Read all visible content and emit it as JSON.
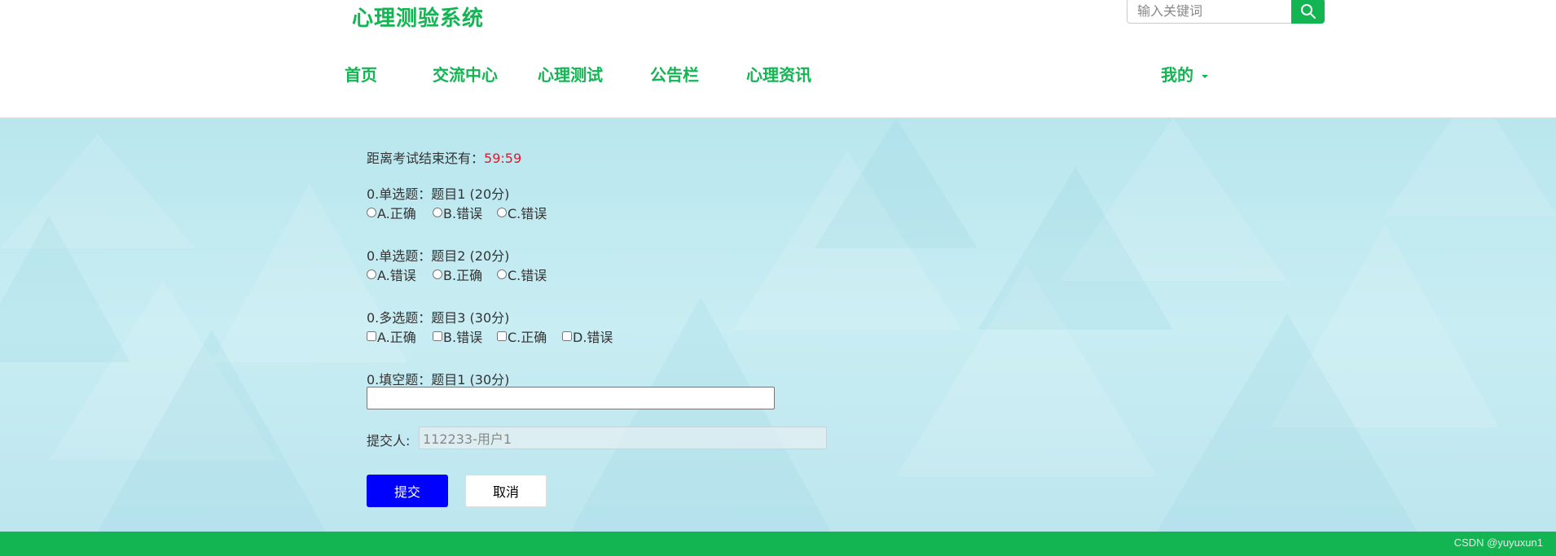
{
  "header": {
    "logo": "心理测验系统",
    "search": {
      "placeholder": "输入关键词",
      "button_icon": "search-icon"
    },
    "nav": [
      {
        "label": "首页"
      },
      {
        "label": "交流中心"
      },
      {
        "label": "心理测试"
      },
      {
        "label": "公告栏"
      },
      {
        "label": "心理资讯"
      }
    ],
    "user_menu": {
      "label": "我的",
      "icon": "caret-down-icon"
    }
  },
  "exam": {
    "timer_label": "距离考试结束还有：",
    "timer_value": "59:59",
    "questions": [
      {
        "title": "0.单选题：题目1 (20分)",
        "type": "radio",
        "options": [
          "A.正确",
          "B.错误",
          "C.错误"
        ]
      },
      {
        "title": "0.单选题：题目2 (20分)",
        "type": "radio",
        "options": [
          "A.错误",
          "B.正确",
          "C.错误"
        ]
      },
      {
        "title": "0.多选题：题目3 (30分)",
        "type": "checkbox",
        "options": [
          "A.正确",
          "B.错误",
          "C.正确",
          "D.错误"
        ]
      },
      {
        "title": "0.填空题：题目1 (30分)",
        "type": "text",
        "value": ""
      }
    ],
    "submitter_label": "提交人:",
    "submitter_value": "112233-用户1",
    "submit_label": "提交",
    "cancel_label": "取消"
  },
  "footer": {
    "watermark": "CSDN @yuyuxun1"
  },
  "colors": {
    "brand": "#12b552",
    "timer": "#e0182e",
    "submit": "#0000ff"
  }
}
